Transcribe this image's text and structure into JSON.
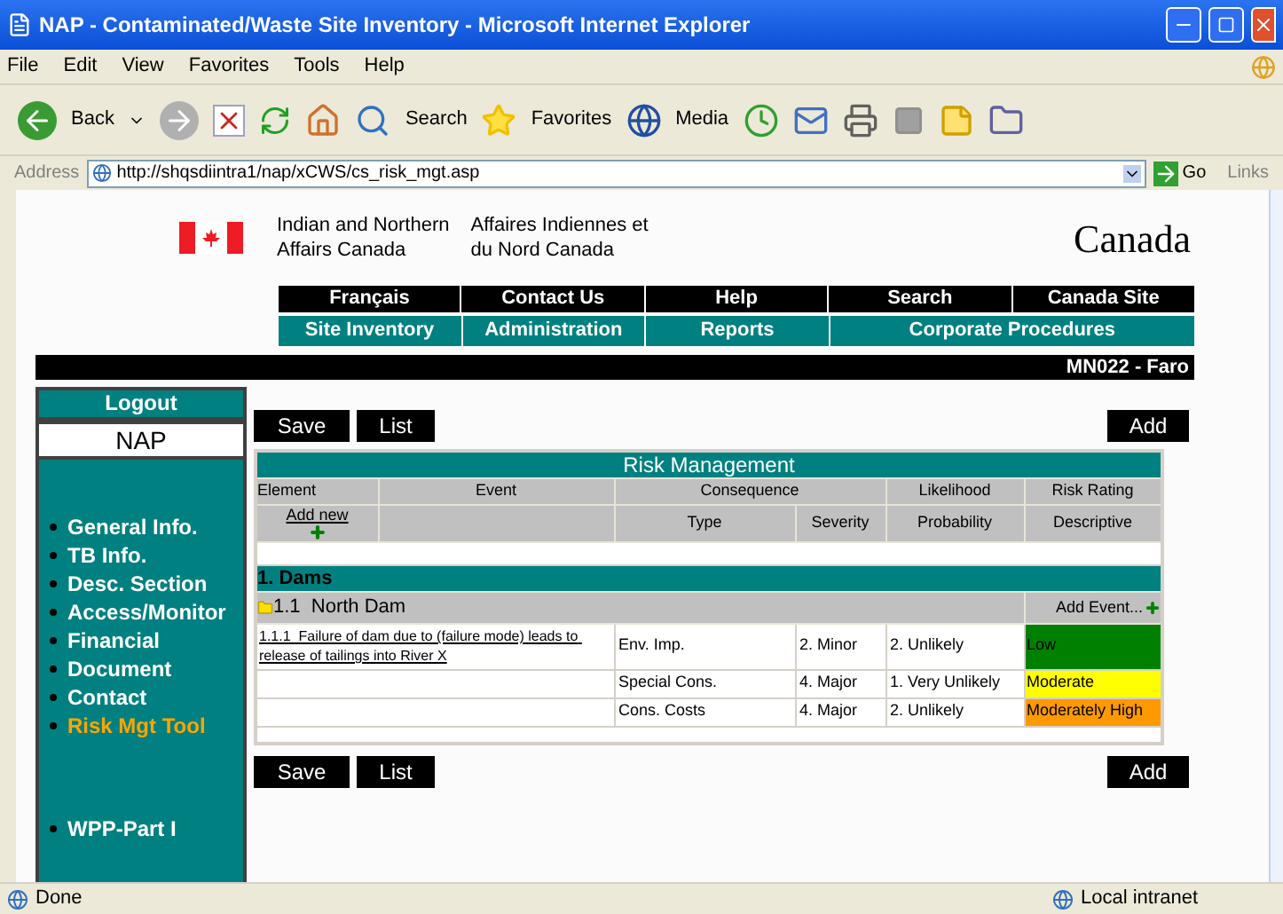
{
  "window": {
    "title": "NAP - Contaminated/Waste Site Inventory - Microsoft Internet Explorer"
  },
  "menu": [
    "File",
    "Edit",
    "View",
    "Favorites",
    "Tools",
    "Help"
  ],
  "toolbar": {
    "back": "Back",
    "search": "Search",
    "favorites": "Favorites",
    "media": "Media"
  },
  "address": {
    "label": "Address",
    "url": "http://shqsdiintra1/nap/xCWS/cs_risk_mgt.asp",
    "go": "Go",
    "links": "Links"
  },
  "header": {
    "org_en": [
      "Indian and Northern",
      "Affairs Canada"
    ],
    "org_fr": [
      "Affaires Indiennes et",
      "du Nord Canada"
    ],
    "wordmark": "Canada"
  },
  "nav_top": [
    "Français",
    "Contact Us",
    "Help",
    "Search",
    "Canada Site"
  ],
  "nav_bottom": [
    "Site Inventory",
    "Administration",
    "Reports",
    "Corporate Procedures"
  ],
  "site_label": "MN022 - Faro",
  "sidebar": {
    "logout": "Logout",
    "app": "NAP",
    "items": [
      {
        "label": "General Info.",
        "selected": false
      },
      {
        "label": "TB Info.",
        "selected": false
      },
      {
        "label": "Desc. Section",
        "selected": false
      },
      {
        "label": "Access/Monitor",
        "selected": false
      },
      {
        "label": "Financial",
        "selected": false
      },
      {
        "label": "Document",
        "selected": false
      },
      {
        "label": "Contact",
        "selected": false
      },
      {
        "label": "Risk Mgt Tool",
        "selected": true
      }
    ],
    "items_lower": [
      {
        "label": "WPP-Part I",
        "selected": false
      }
    ]
  },
  "buttons_top": {
    "save": "Save",
    "list": "List",
    "add": "Add"
  },
  "buttons_bottom": {
    "save": "Save",
    "list": "List",
    "add": "Add"
  },
  "table": {
    "title": "Risk Management",
    "header1": [
      "Element",
      "Event",
      "Consequence",
      "Likelihood",
      "Risk Rating"
    ],
    "header2": [
      "Type",
      "Severity",
      "Probability",
      "Descriptive"
    ],
    "add_new": "Add new",
    "category": "1. Dams",
    "element": "1.1  North Dam",
    "add_event": "Add Event...",
    "event": "1.1.1  Failure of dam due to (failure mode) leads to release of tailings into River X",
    "rows": [
      {
        "type": "Env. Imp.",
        "severity": "2. Minor",
        "probability": "2. Unlikely",
        "rating": "Low",
        "color": "#008000"
      },
      {
        "type": "Special Cons.",
        "severity": "4. Major",
        "probability": "1. Very Unlikely",
        "rating": "Moderate",
        "color": "#ffff00"
      },
      {
        "type": "Cons. Costs",
        "severity": "4. Major",
        "probability": "2. Unlikely",
        "rating": "Moderately High",
        "color": "#ff9900"
      }
    ]
  },
  "status": {
    "text": "Done",
    "zone": "Local intranet"
  }
}
